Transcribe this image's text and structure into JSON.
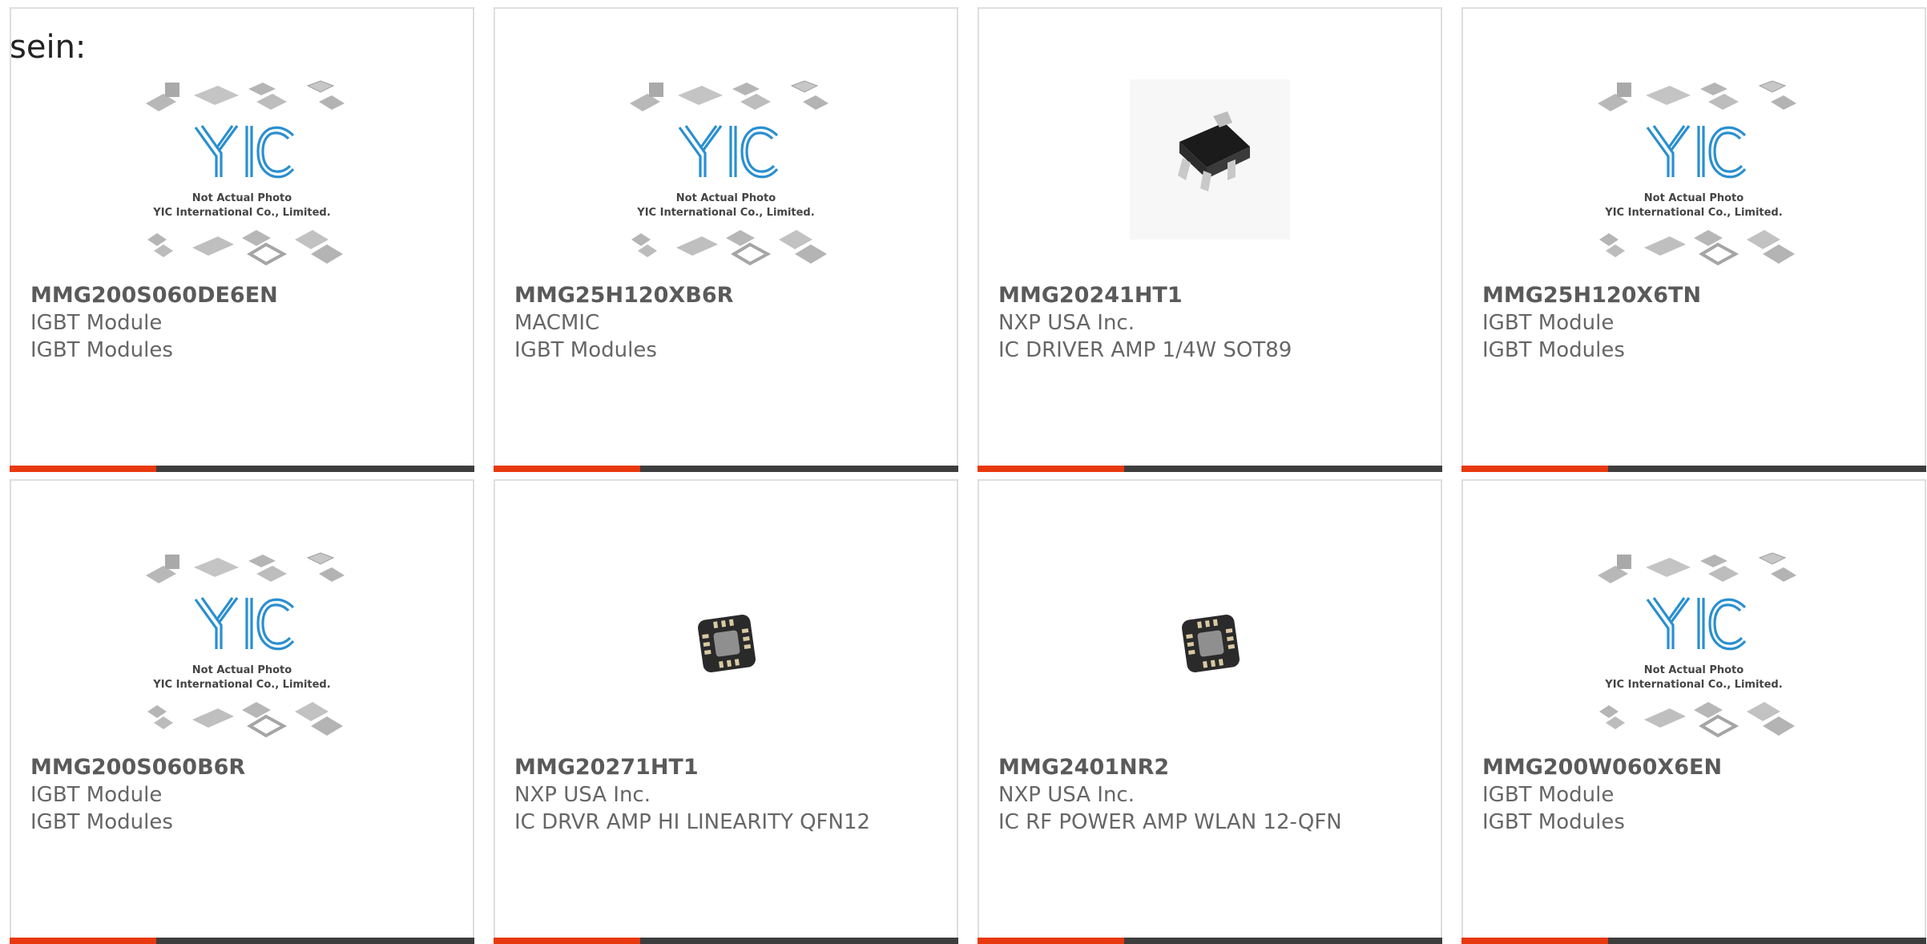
{
  "lead_text": "sein:",
  "colors": {
    "accent": "#e8380d",
    "bar": "#3d3d3d",
    "border": "#dedede",
    "text": "#666666"
  },
  "placeholder": {
    "line1": "Not Actual Photo",
    "line2": "YIC International Co., Limited."
  },
  "products": [
    {
      "part": "MMG200S060DE6EN",
      "maker": "IGBT Module",
      "desc": "IGBT Modules",
      "image": "yic-placeholder"
    },
    {
      "part": "MMG25H120XB6R",
      "maker": "MACMIC",
      "desc": "IGBT Modules",
      "image": "yic-placeholder"
    },
    {
      "part": "MMG20241HT1",
      "maker": "NXP USA Inc.",
      "desc": "IC DRIVER AMP 1/4W SOT89",
      "image": "sot89-chip"
    },
    {
      "part": "MMG25H120X6TN",
      "maker": "IGBT Module",
      "desc": "IGBT Modules",
      "image": "yic-placeholder"
    },
    {
      "part": "MMG200S060B6R",
      "maker": "IGBT Module",
      "desc": "IGBT Modules",
      "image": "yic-placeholder"
    },
    {
      "part": "MMG20271HT1",
      "maker": "NXP USA Inc.",
      "desc": "IC DRVR AMP HI LINEARITY QFN12",
      "image": "qfn-chip"
    },
    {
      "part": "MMG2401NR2",
      "maker": "NXP USA Inc.",
      "desc": "IC RF POWER AMP WLAN 12-QFN",
      "image": "qfn-chip"
    },
    {
      "part": "MMG200W060X6EN",
      "maker": "IGBT Module",
      "desc": "IGBT Modules",
      "image": "yic-placeholder"
    }
  ]
}
